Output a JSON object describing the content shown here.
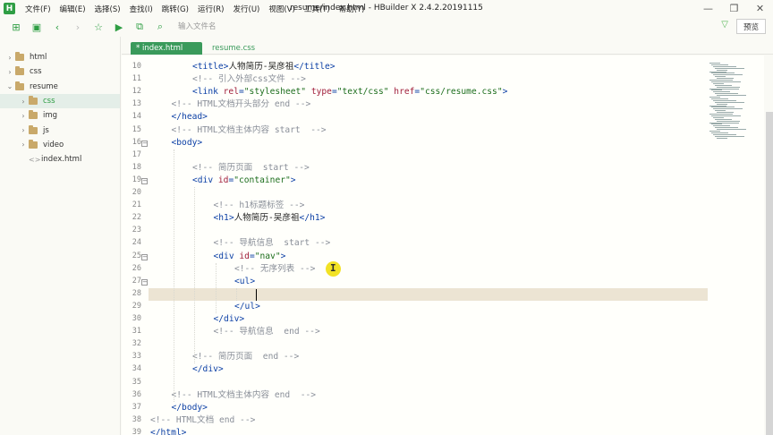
{
  "window": {
    "title": "resume/index.html - HBuilder X 2.4.2.20191115",
    "logo": "H",
    "minimize": "—",
    "restore": "❐",
    "close": "✕"
  },
  "menu": [
    "文件(F)",
    "编辑(E)",
    "选择(S)",
    "查找(I)",
    "跳转(G)",
    "运行(R)",
    "发行(U)",
    "视图(V)",
    "工具(T)",
    "帮助(Y)"
  ],
  "toolbar": {
    "file_input_placeholder": "输入文件名",
    "preview_label": "预览"
  },
  "tabs": [
    {
      "label": "* index.html",
      "active": true
    },
    {
      "label": "resume.css",
      "active": false
    }
  ],
  "tree": [
    {
      "label": "html",
      "type": "folder",
      "level": 0,
      "expanded": false
    },
    {
      "label": "css",
      "type": "folder",
      "level": 0,
      "expanded": false
    },
    {
      "label": "resume",
      "type": "folder",
      "level": 0,
      "expanded": true
    },
    {
      "label": "css",
      "type": "folder",
      "level": 1,
      "expanded": false,
      "selected": true
    },
    {
      "label": "img",
      "type": "folder",
      "level": 1,
      "expanded": false
    },
    {
      "label": "js",
      "type": "folder",
      "level": 1,
      "expanded": false
    },
    {
      "label": "video",
      "type": "folder",
      "level": 1,
      "expanded": false
    },
    {
      "label": "index.html",
      "type": "file",
      "level": 1
    }
  ],
  "code": [
    {
      "n": "10",
      "indent": 2,
      "parts": [
        [
          "tag",
          "<title>"
        ],
        [
          "txt",
          "人物简历-吴彦祖"
        ],
        [
          "tag",
          "</title>"
        ]
      ]
    },
    {
      "n": "11",
      "indent": 2,
      "parts": [
        [
          "cmt",
          "<!-- 引入外部css文件 -->"
        ]
      ]
    },
    {
      "n": "12",
      "indent": 2,
      "parts": [
        [
          "tag",
          "<link "
        ],
        [
          "attr",
          "rel"
        ],
        [
          "tag",
          "="
        ],
        [
          "str",
          "\"stylesheet\""
        ],
        [
          "tag",
          " "
        ],
        [
          "attr",
          "type"
        ],
        [
          "tag",
          "="
        ],
        [
          "str",
          "\"text/css\""
        ],
        [
          "tag",
          " "
        ],
        [
          "attr",
          "href"
        ],
        [
          "tag",
          "="
        ],
        [
          "str",
          "\"css/resume.css\""
        ],
        [
          "tag",
          ">"
        ]
      ]
    },
    {
      "n": "13",
      "indent": 1,
      "parts": [
        [
          "cmt",
          "<!-- HTML文档开头部分 end -->"
        ]
      ]
    },
    {
      "n": "14",
      "indent": 1,
      "parts": [
        [
          "tag",
          "</head>"
        ]
      ]
    },
    {
      "n": "15",
      "indent": 1,
      "parts": [
        [
          "cmt",
          "<!-- HTML文档主体内容 start  -->"
        ]
      ]
    },
    {
      "n": "16",
      "indent": 1,
      "fold": true,
      "parts": [
        [
          "tag",
          "<body>"
        ]
      ]
    },
    {
      "n": "17",
      "indent": 0,
      "parts": []
    },
    {
      "n": "18",
      "indent": 2,
      "parts": [
        [
          "cmt",
          "<!-- 简历页面  start -->"
        ]
      ]
    },
    {
      "n": "19",
      "indent": 2,
      "fold": true,
      "parts": [
        [
          "tag",
          "<div "
        ],
        [
          "attr",
          "id"
        ],
        [
          "tag",
          "="
        ],
        [
          "str",
          "\"container\""
        ],
        [
          "tag",
          ">"
        ]
      ]
    },
    {
      "n": "20",
      "indent": 0,
      "parts": []
    },
    {
      "n": "21",
      "indent": 3,
      "parts": [
        [
          "cmt",
          "<!-- h1标题标签 -->"
        ]
      ]
    },
    {
      "n": "22",
      "indent": 3,
      "parts": [
        [
          "tag",
          "<h1>"
        ],
        [
          "txt",
          "人物简历-吴彦祖"
        ],
        [
          "tag",
          "</h1>"
        ]
      ]
    },
    {
      "n": "23",
      "indent": 0,
      "parts": []
    },
    {
      "n": "24",
      "indent": 3,
      "parts": [
        [
          "cmt",
          "<!-- 导航信息  start -->"
        ]
      ]
    },
    {
      "n": "25",
      "indent": 3,
      "fold": true,
      "parts": [
        [
          "tag",
          "<div "
        ],
        [
          "attr",
          "id"
        ],
        [
          "tag",
          "="
        ],
        [
          "str",
          "\"nav\""
        ],
        [
          "tag",
          ">"
        ]
      ]
    },
    {
      "n": "26",
      "indent": 4,
      "parts": [
        [
          "cmt",
          "<!-- 无序列表 -->"
        ]
      ]
    },
    {
      "n": "27",
      "indent": 4,
      "fold": true,
      "parts": [
        [
          "tag",
          "<ul>"
        ]
      ]
    },
    {
      "n": "28",
      "indent": 0,
      "current": true,
      "parts": []
    },
    {
      "n": "29",
      "indent": 4,
      "parts": [
        [
          "tag",
          "</ul>"
        ]
      ]
    },
    {
      "n": "30",
      "indent": 3,
      "parts": [
        [
          "tag",
          "</div>"
        ]
      ]
    },
    {
      "n": "31",
      "indent": 3,
      "parts": [
        [
          "cmt",
          "<!-- 导航信息  end -->"
        ]
      ]
    },
    {
      "n": "32",
      "indent": 0,
      "parts": []
    },
    {
      "n": "33",
      "indent": 2,
      "parts": [
        [
          "cmt",
          "<!-- 简历页面  end -->"
        ]
      ]
    },
    {
      "n": "34",
      "indent": 2,
      "parts": [
        [
          "tag",
          "</div>"
        ]
      ]
    },
    {
      "n": "35",
      "indent": 0,
      "parts": []
    },
    {
      "n": "36",
      "indent": 1,
      "parts": [
        [
          "cmt",
          "<!-- HTML文档主体内容 end  -->"
        ]
      ]
    },
    {
      "n": "37",
      "indent": 1,
      "parts": [
        [
          "tag",
          "</body>"
        ]
      ]
    },
    {
      "n": "38",
      "indent": 0,
      "parts": [
        [
          "cmt",
          "<!-- HTML文档 end -->"
        ]
      ]
    },
    {
      "n": "39",
      "indent": 0,
      "parts": [
        [
          "tag",
          "</html>"
        ]
      ]
    }
  ],
  "colors": {
    "accent": "#2f9e44",
    "tag": "#0b3fa5",
    "attr": "#a01e3a",
    "string": "#1d6e1d",
    "comment": "#8a8f99",
    "current_line": "#ece4d3"
  }
}
